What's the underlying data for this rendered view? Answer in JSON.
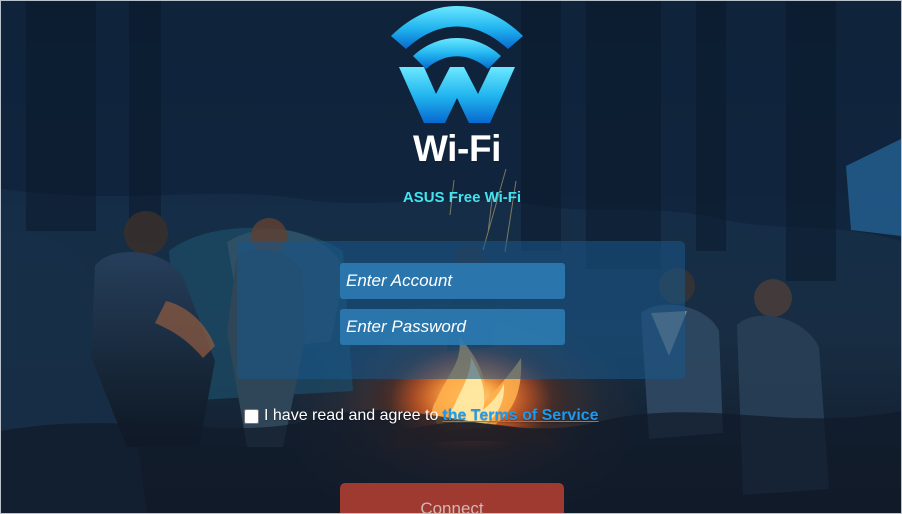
{
  "branding": {
    "logo_icon": "wifi-w-logo",
    "title": "Wi-Fi",
    "subtitle": "ASUS Free Wi-Fi"
  },
  "form": {
    "account_placeholder": "Enter Account",
    "password_placeholder": "Enter Password",
    "terms_text": "I have read and agree to",
    "terms_link": "the Terms of Service",
    "connect_label": "Connect"
  },
  "colors": {
    "subtitle": "#43e4f0",
    "input_background": "#2c7bb3",
    "terms_link": "#1b9af1",
    "connect_button": "#9f3a31"
  }
}
